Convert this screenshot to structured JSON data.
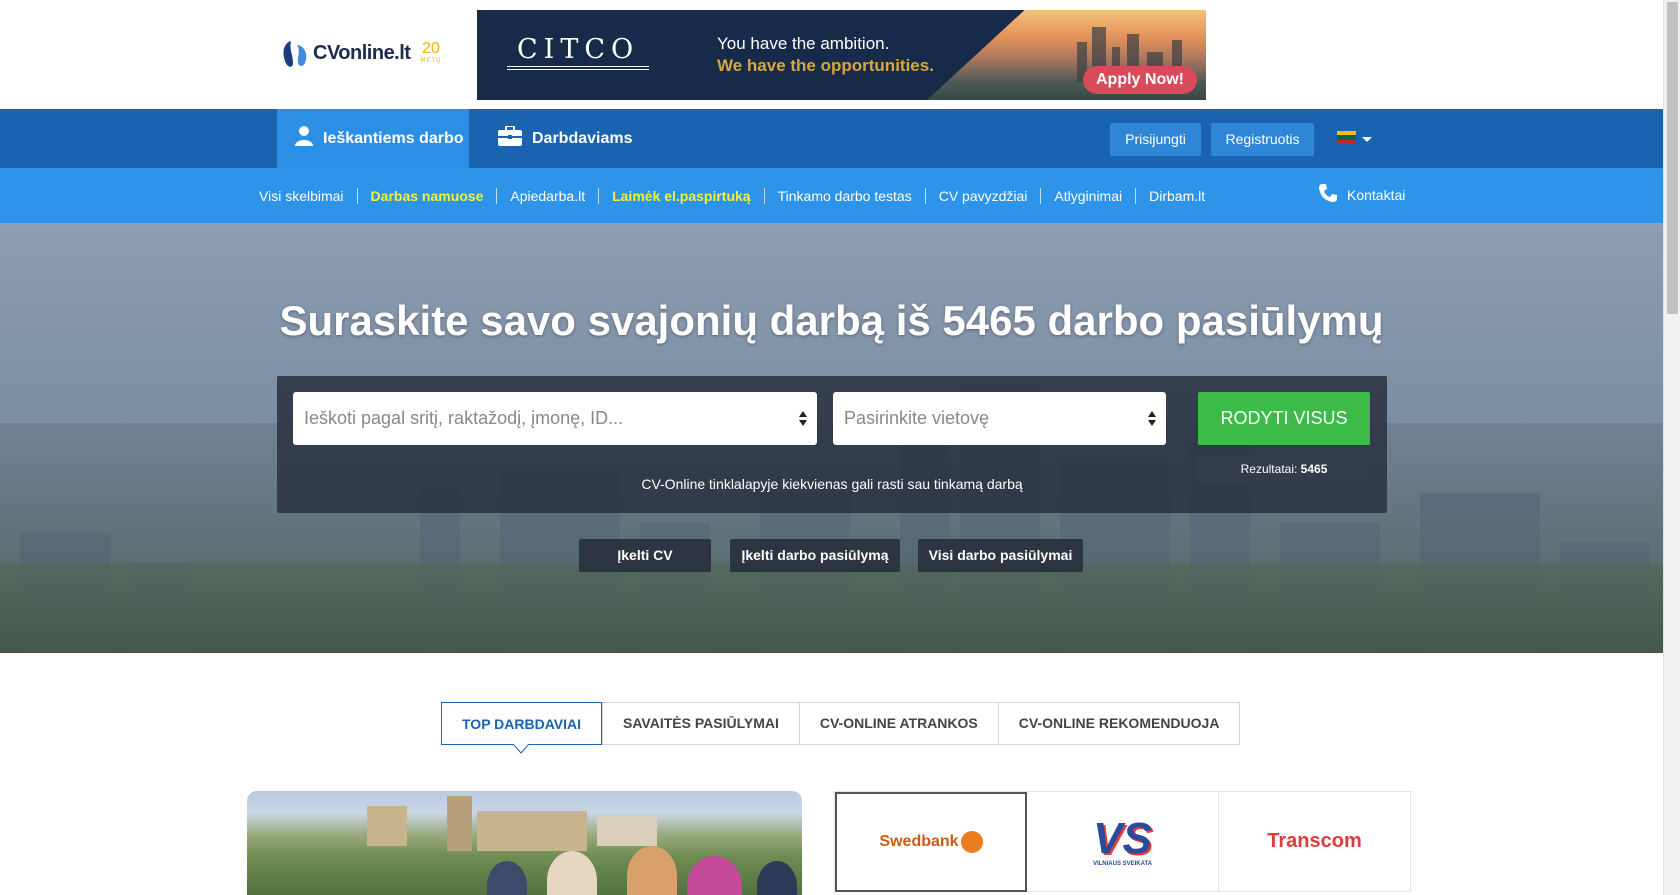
{
  "header": {
    "logo_text": "CVonline.lt",
    "logo_years_num": "20",
    "logo_years_label": "METŲ",
    "ad": {
      "brand": "CITCO",
      "line1": "You have the ambition.",
      "line2": "We have the opportunities.",
      "cta": "Apply Now!"
    }
  },
  "mainnav": {
    "tab_seekers": "Ieškantiems darbo",
    "tab_employers": "Darbdaviams",
    "login": "Prisijungti",
    "register": "Registruotis",
    "language_flag": "LT"
  },
  "subnav": {
    "links": [
      {
        "label": "Visi skelbimai",
        "highlight": false
      },
      {
        "label": "Darbas namuose",
        "highlight": true
      },
      {
        "label": "Apiedarba.lt",
        "highlight": false
      },
      {
        "label": "Laimėk el.paspirtuką",
        "highlight": true
      },
      {
        "label": "Tinkamo darbo testas",
        "highlight": false
      },
      {
        "label": "CV pavyzdžiai",
        "highlight": false
      },
      {
        "label": "Atlyginimai",
        "highlight": false
      },
      {
        "label": "Dirbam.lt",
        "highlight": false
      }
    ],
    "contacts": "Kontaktai"
  },
  "hero": {
    "title": "Suraskite savo svajonių darbą iš 5465 darbo pasiūlymų",
    "search_placeholder": "Ieškoti pagal sritį, raktažodį, įmonę, ID...",
    "location_placeholder": "Pasirinkite vietovę",
    "show_all": "RODYTI VISUS",
    "results_label": "Rezultatai:",
    "results_count": "5465",
    "tagline": "CV-Online tinklalapyje kiekvienas gali rasti sau tinkamą darbą",
    "btn_upload_cv": "Įkelti CV",
    "btn_upload_offer": "Įkelti darbo pasiūlymą",
    "btn_all_offers": "Visi darbo pasiūlymai"
  },
  "tabs": {
    "items": [
      "TOP DARBDAVIAI",
      "SAVAITĖS PASIŪLYMAI",
      "CV-ONLINE ATRANKOS",
      "CV-ONLINE REKOMENDUOJA"
    ],
    "active_index": 0
  },
  "employers": {
    "logos": [
      "Swedbank",
      "VS",
      "Transcom"
    ],
    "vs_sub": "VILNIAUS SVEIKATA"
  },
  "colors": {
    "primary_blue": "#1a63b0",
    "sub_blue": "#2d94ea",
    "green": "#3dbb49",
    "highlight_yellow": "#f5ee3a"
  }
}
